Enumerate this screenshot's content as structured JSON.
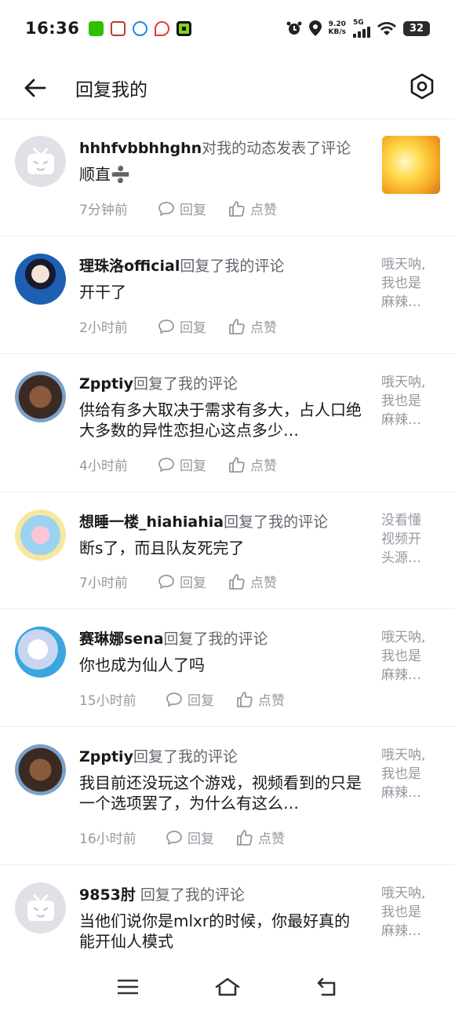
{
  "status_bar": {
    "time": "16:36",
    "net_speed_value": "9.20",
    "net_speed_unit": "KB/s",
    "signal": "5G",
    "battery": "32"
  },
  "header": {
    "title": "回复我的",
    "back_icon": "arrow-left-icon",
    "settings_icon": "hexagon-settings-icon"
  },
  "items": [
    {
      "user": "hhhfvbbhhghn",
      "action": "对我的动态发表了评论",
      "text": "顺直➗",
      "time": "7分钟前",
      "reply_label": "回复",
      "like_label": "点赞",
      "ref_type": "thumbnail"
    },
    {
      "user": "理珠洛official",
      "action": "回复了我的评论",
      "text": "开干了",
      "time": "2小时前",
      "reply_label": "回复",
      "like_label": "点赞",
      "ref_lines": [
        "哦天呐,",
        "我也是",
        "麻辣…"
      ]
    },
    {
      "user": "Zpptiy",
      "action": "回复了我的评论",
      "text": "供给有多大取决于需求有多大，占人口绝大多数的异性恋担心这点多少…",
      "time": "4小时前",
      "reply_label": "回复",
      "like_label": "点赞",
      "ref_lines": [
        "哦天呐,",
        "我也是",
        "麻辣…"
      ]
    },
    {
      "user": "想睡一楼_hiahiahia",
      "action": "回复了我的评论",
      "text": "断s了，而且队友死完了",
      "time": "7小时前",
      "reply_label": "回复",
      "like_label": "点赞",
      "ref_lines": [
        "没看懂",
        "视频开",
        "头源…"
      ]
    },
    {
      "user": "赛琳娜sena",
      "action": "回复了我的评论",
      "text": "你也成为仙人了吗",
      "time": "15小时前",
      "reply_label": "回复",
      "like_label": "点赞",
      "ref_lines": [
        "哦天呐,",
        "我也是",
        "麻辣…"
      ]
    },
    {
      "user": "Zpptiy",
      "action": "回复了我的评论",
      "text": "我目前还没玩这个游戏，视频看到的只是一个选项罢了，为什么有这么…",
      "time": "16小时前",
      "reply_label": "回复",
      "like_label": "点赞",
      "ref_lines": [
        "哦天呐,",
        "我也是",
        "麻辣…"
      ]
    },
    {
      "user": "9853肘",
      "action": "回复了我的评论",
      "text": "当他们说你是mlxr的时候，你最好真的能开仙人模式",
      "time": "",
      "reply_label": "",
      "like_label": "",
      "ref_lines": [
        "哦天呐,",
        "我也是",
        "麻辣…"
      ]
    }
  ],
  "navbar": {
    "menu_icon": "menu-icon",
    "home_icon": "home-icon",
    "back_icon": "back-gesture-icon"
  }
}
